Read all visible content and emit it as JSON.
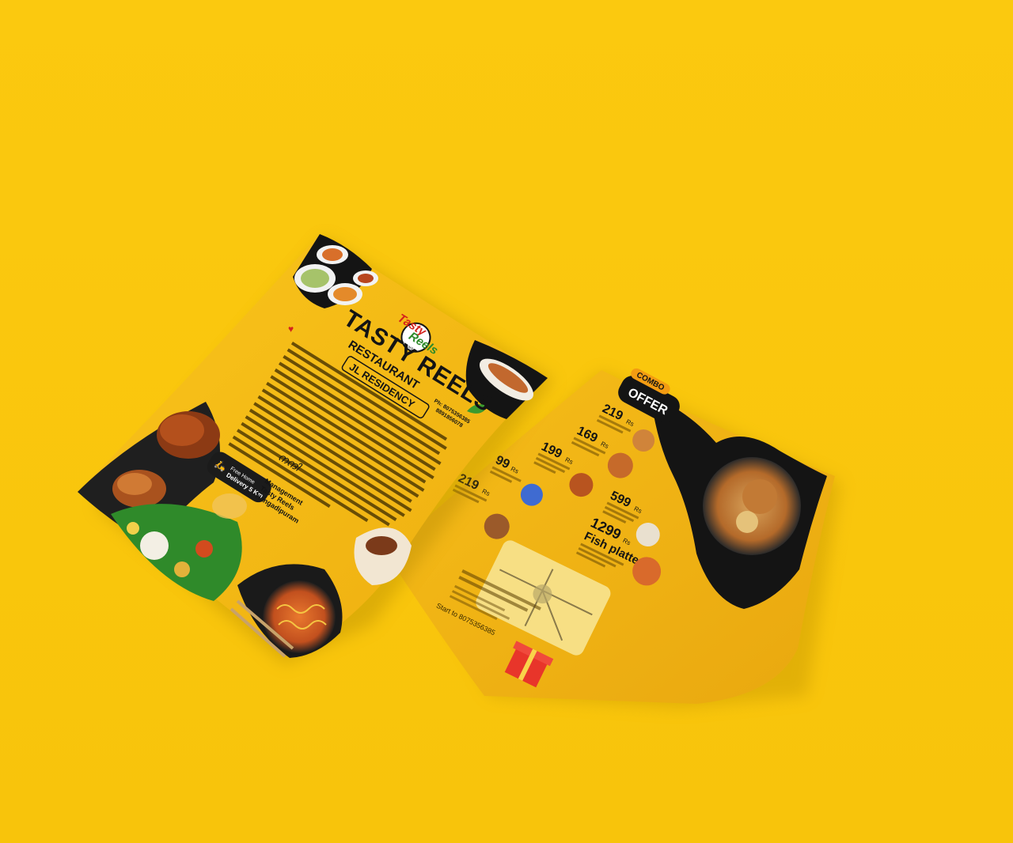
{
  "background_color": "#fbc90f",
  "front_flyer": {
    "brand_logo_line1": "Tasty",
    "brand_logo_line2": "Reels",
    "brand_logo_tag": "Restaurant",
    "title": "TASTY REELS",
    "subtitle": "RESTAURANT",
    "location_badge": "JL RESIDENCY",
    "phone_line1": "Ph: 8075356385",
    "phone_line2": "8891856078",
    "delivery_line1": "Free Home",
    "delivery_line2": "Delivery 5 Km",
    "signoff_line1": "Management",
    "signoff_line2": "Tasty Reels",
    "signoff_line3": "Hangadipuram",
    "signoff_script": "നന്ദി"
  },
  "back_flyer": {
    "combo_badge_line1": "COMBO",
    "combo_badge_line2": "OFFER",
    "offers": [
      {
        "price": "219",
        "unit": "Rs"
      },
      {
        "price": "169",
        "unit": "Rs"
      },
      {
        "price": "199",
        "unit": "Rs"
      },
      {
        "price": "99",
        "unit": "Rs"
      },
      {
        "price": "599",
        "unit": "Rs"
      },
      {
        "price": "219",
        "unit": "Rs"
      },
      {
        "price": "1299",
        "unit": "Rs",
        "name": "Fish platter"
      }
    ],
    "contact_line": "Start to 8075356385"
  },
  "colors": {
    "flyer_yellow": "#f7c11a",
    "flyer_deep": "#e2a40c",
    "black": "#141414",
    "leaf_green": "#2f8a2a",
    "map_panel": "#f7df84"
  }
}
